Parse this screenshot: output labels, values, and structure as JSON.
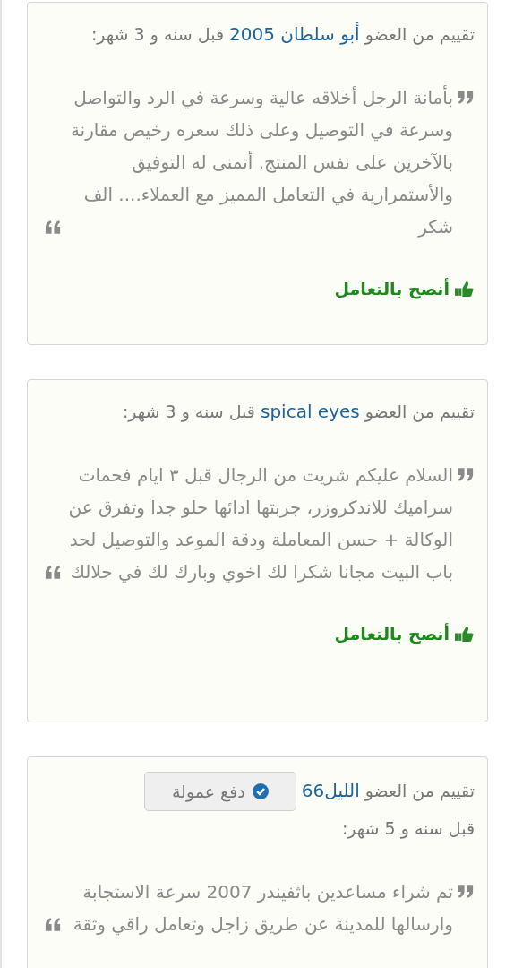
{
  "reviews": [
    {
      "prefix": "تقييم من العضو",
      "member": "أبو سلطان 2005",
      "time": "قبل سنه و 3 شهر:",
      "text": "بأمانة الرجل أخلاقه عالية وسرعة في الرد والتواصل وسرعة في التوصيل وعلى ذلك سعره رخيص مقارنة بالآخرين على نفس المنتج. أتمنى له التوفيق والأستمرارية في التعامل المميز مع العملاء.... الف شكر",
      "recommendation": "أنصح بالتعامل"
    },
    {
      "prefix": "تقييم من العضو",
      "member": "spical eyes",
      "time": "قبل سنه و 3 شهر:",
      "text": "السلام عليكم شريت من الرجال قبل ٣ ايام فحمات سراميك للاندكروزر، جربتها ادائها حلو جدا وتفرق عن الوكالة + حسن المعاملة ودقة الموعد والتوصيل لحد باب البيت مجانا شكرا لك اخوي وبارك لك في حلالك",
      "recommendation": "أنصح بالتعامل"
    },
    {
      "prefix": "تقييم من العضو",
      "member": "الليل66",
      "badge": "دفع عمولة",
      "time": "قبل سنه و 5 شهر:",
      "text": "تم شراء مساعدين باثفيندر 2007 سرعة الاستجابة وارسالها للمدينة عن طريق زاجل وتعامل راقي وثقة"
    }
  ]
}
